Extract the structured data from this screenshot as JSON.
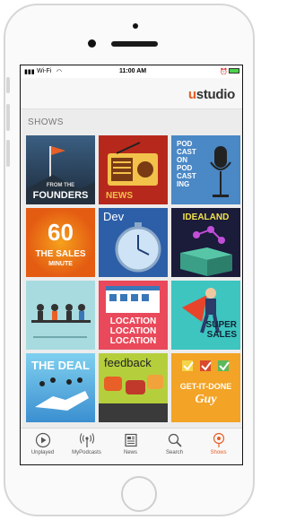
{
  "status": {
    "carrier": "Wi-Fi",
    "time": "11:00 AM"
  },
  "header": {
    "logo_u": "u",
    "logo_rest": "studio"
  },
  "section_title": "SHOWS",
  "shows": [
    {
      "line1": "FROM THE",
      "line2": "FOUNDERS"
    },
    {
      "line1": "NEWS"
    },
    {
      "line1": "POD",
      "line2": "CAST",
      "line3": "ON",
      "line4": "POD",
      "line5": "CAST",
      "line6": "ING"
    },
    {
      "line1": "60",
      "line2": "THE SALES",
      "line3": "MINUTE"
    },
    {
      "line1": "Dev"
    },
    {
      "line1": "IDEALAND"
    },
    {
      "line1": ""
    },
    {
      "line1": "LOCATION",
      "line2": "LOCATION",
      "line3": "LOCATION"
    },
    {
      "line1": "SUPER",
      "line2": "SALES"
    },
    {
      "line1": "THE DEAL"
    },
    {
      "line1": "feedback"
    },
    {
      "line1": "GET-IT-DONE",
      "line2": "Guy"
    }
  ],
  "tabs": [
    {
      "label": "Unplayed"
    },
    {
      "label": "MyPodcasts"
    },
    {
      "label": "News"
    },
    {
      "label": "Search"
    },
    {
      "label": "Shows",
      "active": true
    }
  ],
  "colors": {
    "accent": "#e85f27",
    "tab_inactive": "#555555"
  }
}
